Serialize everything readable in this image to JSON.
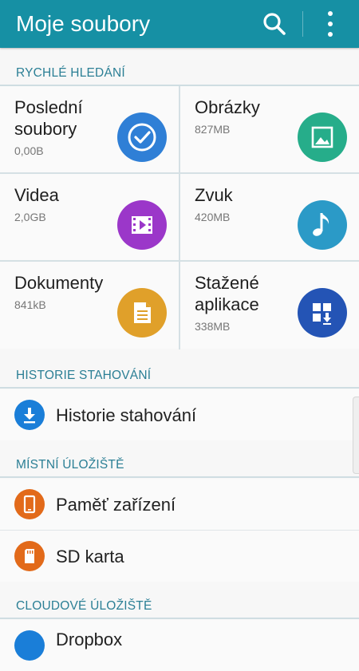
{
  "app_title": "Moje soubory",
  "icons": {
    "search": "search-icon",
    "more": "more-vert-icon"
  },
  "quick_search": {
    "header": "RYCHLÉ HLEDÁNÍ",
    "tiles": [
      {
        "name": "Poslední soubory",
        "line1": "Poslední",
        "line2": "soubory",
        "size": "0,00B",
        "icon": "clock-check-icon",
        "color": "#2f7fd6"
      },
      {
        "name": "Obrázky",
        "line1": "Obrázky",
        "line2": "",
        "size": "827MB",
        "icon": "image-icon",
        "color": "#26ad8a"
      },
      {
        "name": "Videa",
        "line1": "Videa",
        "line2": "",
        "size": "2,0GB",
        "icon": "video-icon",
        "color": "#9b37c9"
      },
      {
        "name": "Zvuk",
        "line1": "Zvuk",
        "line2": "",
        "size": "420MB",
        "icon": "music-note-icon",
        "color": "#2b9ac7"
      },
      {
        "name": "Dokumenty",
        "line1": "Dokumenty",
        "line2": "",
        "size": "841kB",
        "icon": "document-icon",
        "color": "#e0a02a"
      },
      {
        "name": "Stažené aplikace",
        "line1": "Stažené",
        "line2": "aplikace",
        "size": "338MB",
        "icon": "apps-download-icon",
        "color": "#2454b5"
      }
    ]
  },
  "download_history": {
    "header": "HISTORIE STAHOVÁNÍ",
    "items": [
      {
        "label": "Historie stahování",
        "icon": "download-icon",
        "color": "#1a7ed8"
      }
    ]
  },
  "local_storage": {
    "header": "MÍSTNÍ ÚLOŽIŠTĚ",
    "items": [
      {
        "label": "Paměť zařízení",
        "icon": "phone-icon",
        "color": "#e26a1a"
      },
      {
        "label": "SD karta",
        "icon": "sd-card-icon",
        "color": "#e26a1a"
      }
    ]
  },
  "cloud_storage": {
    "header": "CLOUDOVÉ ÚLOŽIŠTĚ",
    "items": [
      {
        "label": "Dropbox",
        "icon": "dropbox-icon",
        "color": "#1a7ed8"
      }
    ]
  }
}
